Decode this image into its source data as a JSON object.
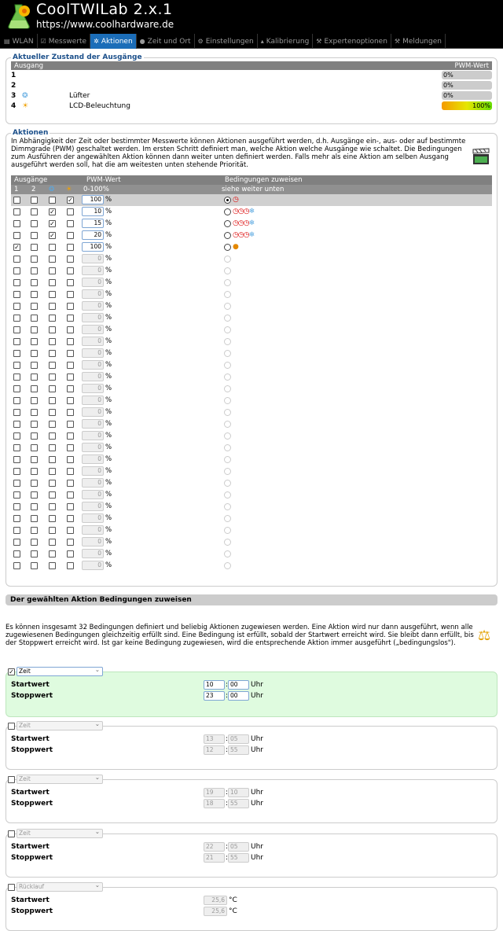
{
  "header": {
    "title": "CoolTWILab 2.x.1",
    "url": "https://www.coolhardware.de"
  },
  "nav": {
    "tabs": [
      {
        "label": "WLAN",
        "icon": "wifi-icon",
        "active": false
      },
      {
        "label": "Messwerte",
        "icon": "chart-icon",
        "active": false
      },
      {
        "label": "Aktionen",
        "icon": "fan-icon",
        "active": true
      },
      {
        "label": "Zeit und Ort",
        "icon": "globe-icon",
        "active": false
      },
      {
        "label": "Einstellungen",
        "icon": "gear-icon",
        "active": false
      },
      {
        "label": "Kalibrierung",
        "icon": "wrench-icon",
        "active": false
      },
      {
        "label": "Expertenoptionen",
        "icon": "tool-icon",
        "active": false
      },
      {
        "label": "Meldungen",
        "icon": "wrench-icon",
        "active": false
      }
    ]
  },
  "state": {
    "legend": "Aktueller Zustand der Ausgänge",
    "col_output": "Ausgang",
    "col_pwm": "PWM-Wert",
    "rows": [
      {
        "num": "1",
        "name": "",
        "pwm": "0%",
        "level": 0
      },
      {
        "num": "2",
        "name": "",
        "pwm": "0%",
        "level": 0
      },
      {
        "num": "3",
        "name": "Lüfter",
        "pwm": "0%",
        "level": 0
      },
      {
        "num": "4",
        "name": "LCD-Beleuchtung",
        "pwm": "100%",
        "level": 100
      }
    ]
  },
  "actions": {
    "legend": "Aktionen",
    "intro": "In Abhängigkeit der Zeit oder bestimmter Messwerte können Aktionen ausgeführt werden, d.h. Ausgänge ein-, aus- oder auf bestimmte Dimmgrade (PWM) geschaltet werden. Im ersten Schritt definiert man, welche Aktion welche Ausgänge wie schaltet. Die Bedingungen zum Ausführen der angewählten Aktion können dann weiter unten definiert werden. Falls mehr als eine Aktion am selben Ausgang ausgeführt werden soll, hat die am weitesten unten stehende Priorität.",
    "head_outputs": "Ausgänge",
    "head_pwm": "PWM-Wert",
    "head_cond": "Bedingungen zuweisen",
    "sub_1": "1",
    "sub_2": "2",
    "sub_pwm": "0-100%",
    "sub_cond": "siehe weiter unten",
    "pct_sign": "%"
  },
  "assign": {
    "title": "Der gewählten Aktion Bedingungen zuweisen",
    "intro": "Es können insgesamt 32 Bedingungen definiert und beliebig Aktionen zugewiesen werden. Eine Aktion wird nur dann ausgeführt, wenn alle zugewiesenen Bedingungen gleichzeitig erfüllt sind. Eine Bedingung ist erfüllt, sobald der Startwert erreicht wird. Sie bleibt dann erfüllt, bis der Stoppwert erreicht wird. Ist gar keine Bedingung zugewiesen, wird die entsprechende Aktion immer ausgeführt („bedingungslos\").",
    "start_label": "Startwert",
    "stop_label": "Stoppwert",
    "uhr": "Uhr",
    "conditions": [
      {
        "type": "Zeit",
        "checked": true,
        "start_h": "10",
        "start_m": "00",
        "stop_h": "23",
        "stop_m": "00"
      },
      {
        "type": "Zeit",
        "checked": false,
        "start_h": "13",
        "start_m": "05",
        "stop_h": "12",
        "stop_m": "55"
      },
      {
        "type": "Zeit",
        "checked": false,
        "start_h": "19",
        "start_m": "10",
        "stop_h": "18",
        "stop_m": "55"
      },
      {
        "type": "Zeit",
        "checked": false,
        "start_h": "22",
        "start_m": "05",
        "stop_h": "21",
        "stop_m": "55"
      },
      {
        "type": "Rücklauf",
        "checked": false,
        "start_val": "25,6",
        "stop_val": "25,6",
        "unit": "°C"
      }
    ]
  }
}
